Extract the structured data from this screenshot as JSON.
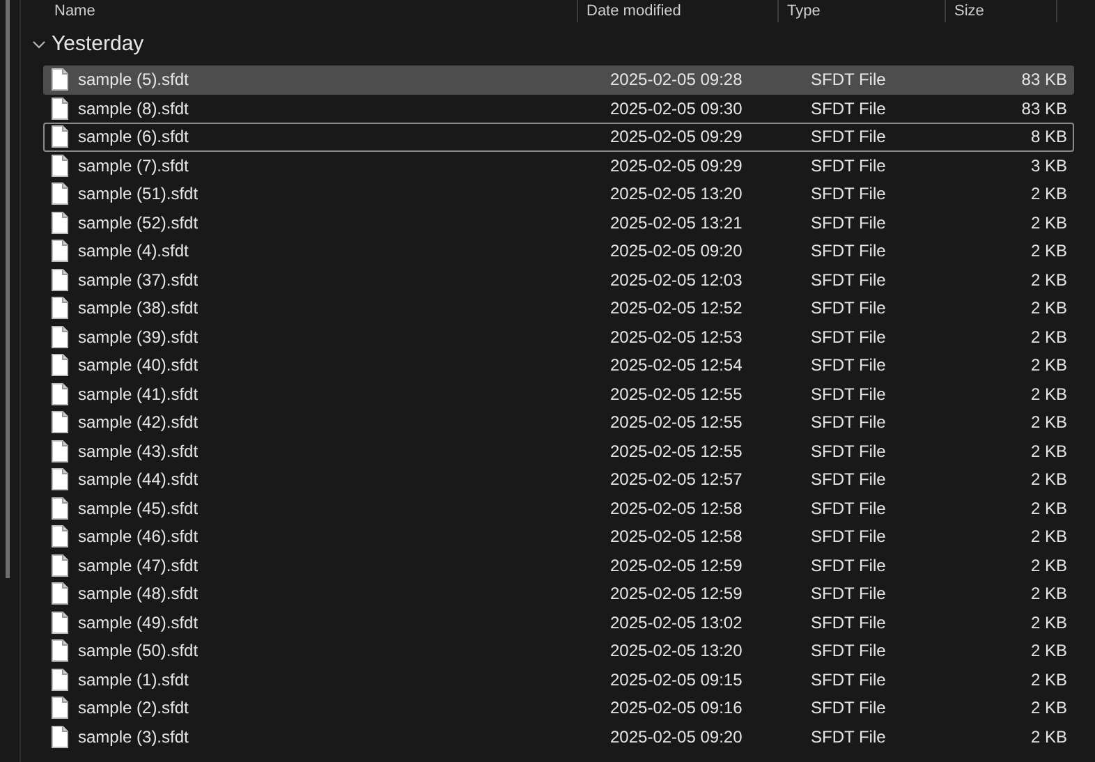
{
  "columns": [
    "Name",
    "Date modified",
    "Type",
    "Size"
  ],
  "group": {
    "label": "Yesterday",
    "expanded": true
  },
  "rows": [
    {
      "name": "sample (5).sfdt",
      "date": "2025-02-05 09:28",
      "type": "SFDT File",
      "size": "83 KB",
      "selected": true,
      "focused": false
    },
    {
      "name": "sample (8).sfdt",
      "date": "2025-02-05 09:30",
      "type": "SFDT File",
      "size": "83 KB",
      "selected": false,
      "focused": false
    },
    {
      "name": "sample (6).sfdt",
      "date": "2025-02-05 09:29",
      "type": "SFDT File",
      "size": "8 KB",
      "selected": false,
      "focused": true
    },
    {
      "name": "sample (7).sfdt",
      "date": "2025-02-05 09:29",
      "type": "SFDT File",
      "size": "3 KB",
      "selected": false,
      "focused": false
    },
    {
      "name": "sample (51).sfdt",
      "date": "2025-02-05 13:20",
      "type": "SFDT File",
      "size": "2 KB",
      "selected": false,
      "focused": false
    },
    {
      "name": "sample (52).sfdt",
      "date": "2025-02-05 13:21",
      "type": "SFDT File",
      "size": "2 KB",
      "selected": false,
      "focused": false
    },
    {
      "name": "sample (4).sfdt",
      "date": "2025-02-05 09:20",
      "type": "SFDT File",
      "size": "2 KB",
      "selected": false,
      "focused": false
    },
    {
      "name": "sample (37).sfdt",
      "date": "2025-02-05 12:03",
      "type": "SFDT File",
      "size": "2 KB",
      "selected": false,
      "focused": false
    },
    {
      "name": "sample (38).sfdt",
      "date": "2025-02-05 12:52",
      "type": "SFDT File",
      "size": "2 KB",
      "selected": false,
      "focused": false
    },
    {
      "name": "sample (39).sfdt",
      "date": "2025-02-05 12:53",
      "type": "SFDT File",
      "size": "2 KB",
      "selected": false,
      "focused": false
    },
    {
      "name": "sample (40).sfdt",
      "date": "2025-02-05 12:54",
      "type": "SFDT File",
      "size": "2 KB",
      "selected": false,
      "focused": false
    },
    {
      "name": "sample (41).sfdt",
      "date": "2025-02-05 12:55",
      "type": "SFDT File",
      "size": "2 KB",
      "selected": false,
      "focused": false
    },
    {
      "name": "sample (42).sfdt",
      "date": "2025-02-05 12:55",
      "type": "SFDT File",
      "size": "2 KB",
      "selected": false,
      "focused": false
    },
    {
      "name": "sample (43).sfdt",
      "date": "2025-02-05 12:55",
      "type": "SFDT File",
      "size": "2 KB",
      "selected": false,
      "focused": false
    },
    {
      "name": "sample (44).sfdt",
      "date": "2025-02-05 12:57",
      "type": "SFDT File",
      "size": "2 KB",
      "selected": false,
      "focused": false
    },
    {
      "name": "sample (45).sfdt",
      "date": "2025-02-05 12:58",
      "type": "SFDT File",
      "size": "2 KB",
      "selected": false,
      "focused": false
    },
    {
      "name": "sample (46).sfdt",
      "date": "2025-02-05 12:58",
      "type": "SFDT File",
      "size": "2 KB",
      "selected": false,
      "focused": false
    },
    {
      "name": "sample (47).sfdt",
      "date": "2025-02-05 12:59",
      "type": "SFDT File",
      "size": "2 KB",
      "selected": false,
      "focused": false
    },
    {
      "name": "sample (48).sfdt",
      "date": "2025-02-05 12:59",
      "type": "SFDT File",
      "size": "2 KB",
      "selected": false,
      "focused": false
    },
    {
      "name": "sample (49).sfdt",
      "date": "2025-02-05 13:02",
      "type": "SFDT File",
      "size": "2 KB",
      "selected": false,
      "focused": false
    },
    {
      "name": "sample (50).sfdt",
      "date": "2025-02-05 13:20",
      "type": "SFDT File",
      "size": "2 KB",
      "selected": false,
      "focused": false
    },
    {
      "name": "sample (1).sfdt",
      "date": "2025-02-05 09:15",
      "type": "SFDT File",
      "size": "2 KB",
      "selected": false,
      "focused": false
    },
    {
      "name": "sample (2).sfdt",
      "date": "2025-02-05 09:16",
      "type": "SFDT File",
      "size": "2 KB",
      "selected": false,
      "focused": false
    },
    {
      "name": "sample (3).sfdt",
      "date": "2025-02-05 09:20",
      "type": "SFDT File",
      "size": "2 KB",
      "selected": false,
      "focused": false
    }
  ]
}
